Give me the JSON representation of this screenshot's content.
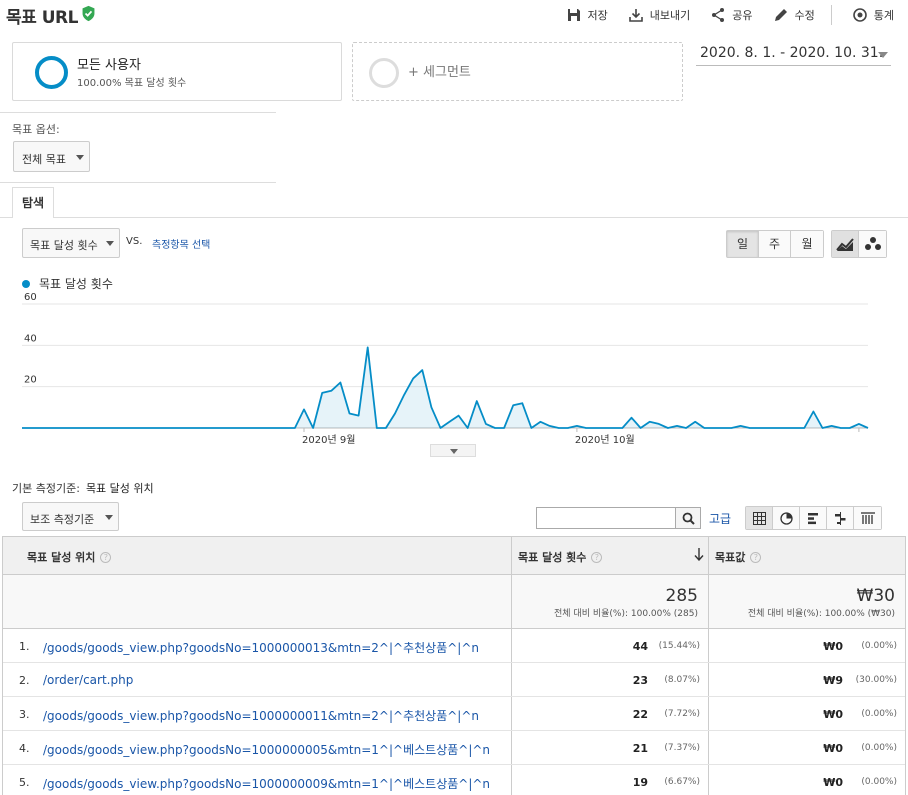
{
  "header": {
    "title": "목표 URL",
    "actions": {
      "save": "저장",
      "export": "내보내기",
      "share": "공유",
      "edit": "수정",
      "insights": "통계"
    }
  },
  "segments": {
    "active_name": "모든 사용자",
    "active_sub": "100.00% 목표 달성 횟수",
    "add_label": "+ 세그먼트",
    "active_color": "#058dc7"
  },
  "date_range": "2020. 8. 1. - 2020. 10. 31.",
  "goal_option": {
    "label": "목표 옵션:",
    "selected": "전체 목표"
  },
  "tabs": {
    "explore": "탐색"
  },
  "metric": {
    "selected": "목표 달성 횟수",
    "vs": "VS.",
    "pick": "측정항목 선택"
  },
  "period": {
    "day": "일",
    "week": "주",
    "month": "월",
    "active": "day"
  },
  "chart_data": {
    "type": "area",
    "series": [
      {
        "name": "목표 달성 횟수",
        "color": "#058dc7",
        "values": [
          0,
          0,
          0,
          0,
          0,
          0,
          0,
          0,
          0,
          0,
          0,
          0,
          0,
          0,
          0,
          0,
          0,
          0,
          0,
          0,
          0,
          0,
          0,
          0,
          0,
          0,
          0,
          0,
          0,
          0,
          0,
          9,
          0,
          17,
          18,
          22,
          7,
          6,
          39,
          0,
          0,
          7,
          16,
          24,
          28,
          10,
          0,
          3,
          6,
          0,
          13,
          2,
          0,
          0,
          11,
          12,
          0,
          3,
          1,
          0,
          0,
          1,
          0,
          0,
          0,
          0,
          0,
          5,
          0,
          3,
          2,
          0,
          1,
          0,
          3,
          0,
          0,
          0,
          0,
          1,
          0,
          0,
          0,
          0,
          0,
          0,
          0,
          8,
          0,
          1,
          0,
          0,
          2,
          0
        ]
      }
    ],
    "x_start": "2020-08-01",
    "x_end": "2020-10-31",
    "x_tick_labels": [
      "2020년 9월",
      "2020년 10월"
    ],
    "y_ticks": [
      20,
      40,
      60
    ],
    "ylim": [
      0,
      60
    ],
    "grid": true
  },
  "dimension": {
    "primary_label": "기본 측정기준:",
    "primary_value": "목표 달성 위치",
    "secondary_select": "보조 측정기준",
    "advanced": "고급",
    "search_placeholder": ""
  },
  "table": {
    "columns": [
      "목표 달성 위치",
      "목표 달성 횟수",
      "목표값"
    ],
    "total": {
      "completions": "285",
      "completions_sub": "전체 대비 비율(%): 100.00% (285)",
      "value": "₩30",
      "value_sub": "전체 대비 비율(%): 100.00% (₩30)"
    },
    "rows": [
      {
        "idx": "1.",
        "url": "/goods/goods_view.php?goodsNo=1000000013&mtn=2^|^추천상품^|^n",
        "count": "44",
        "count_pct": "(15.44%)",
        "value": "₩0",
        "value_pct": "(0.00%)"
      },
      {
        "idx": "2.",
        "url": "/order/cart.php",
        "count": "23",
        "count_pct": "(8.07%)",
        "value": "₩9",
        "value_pct": "(30.00%)"
      },
      {
        "idx": "3.",
        "url": "/goods/goods_view.php?goodsNo=1000000011&mtn=2^|^추천상품^|^n",
        "count": "22",
        "count_pct": "(7.72%)",
        "value": "₩0",
        "value_pct": "(0.00%)"
      },
      {
        "idx": "4.",
        "url": "/goods/goods_view.php?goodsNo=1000000005&mtn=1^|^베스트상품^|^n",
        "count": "21",
        "count_pct": "(7.37%)",
        "value": "₩0",
        "value_pct": "(0.00%)"
      },
      {
        "idx": "5.",
        "url": "/goods/goods_view.php?goodsNo=1000000009&mtn=1^|^베스트상품^|^n",
        "count": "19",
        "count_pct": "(6.67%)",
        "value": "₩0",
        "value_pct": "(0.00%)"
      }
    ]
  }
}
